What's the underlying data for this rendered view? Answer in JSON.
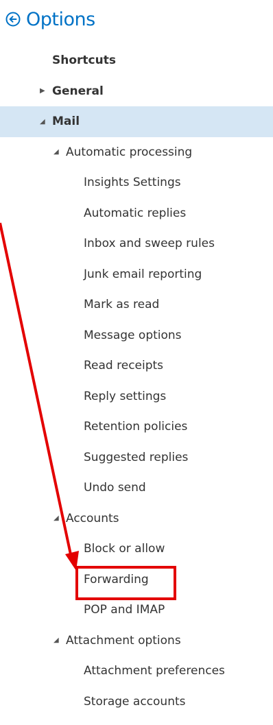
{
  "header": {
    "title": "Options",
    "back_icon": "back-circle-arrow-icon"
  },
  "nav": {
    "shortcuts": "Shortcuts",
    "general": "General",
    "mail": "Mail",
    "automatic_processing": {
      "label": "Automatic processing",
      "items": [
        "Insights Settings",
        "Automatic replies",
        "Inbox and sweep rules",
        "Junk email reporting",
        "Mark as read",
        "Message options",
        "Read receipts",
        "Reply settings",
        "Retention policies",
        "Suggested replies",
        "Undo send"
      ]
    },
    "accounts": {
      "label": "Accounts",
      "items": [
        "Block or allow",
        "Forwarding",
        "POP and IMAP"
      ]
    },
    "attachment_options": {
      "label": "Attachment options",
      "items": [
        "Attachment preferences",
        "Storage accounts"
      ]
    }
  },
  "colors": {
    "accent": "#0072c6",
    "selected_bg": "#d5e6f4",
    "annotation": "#e30000"
  },
  "annotation": {
    "highlighted_item": "Forwarding"
  }
}
